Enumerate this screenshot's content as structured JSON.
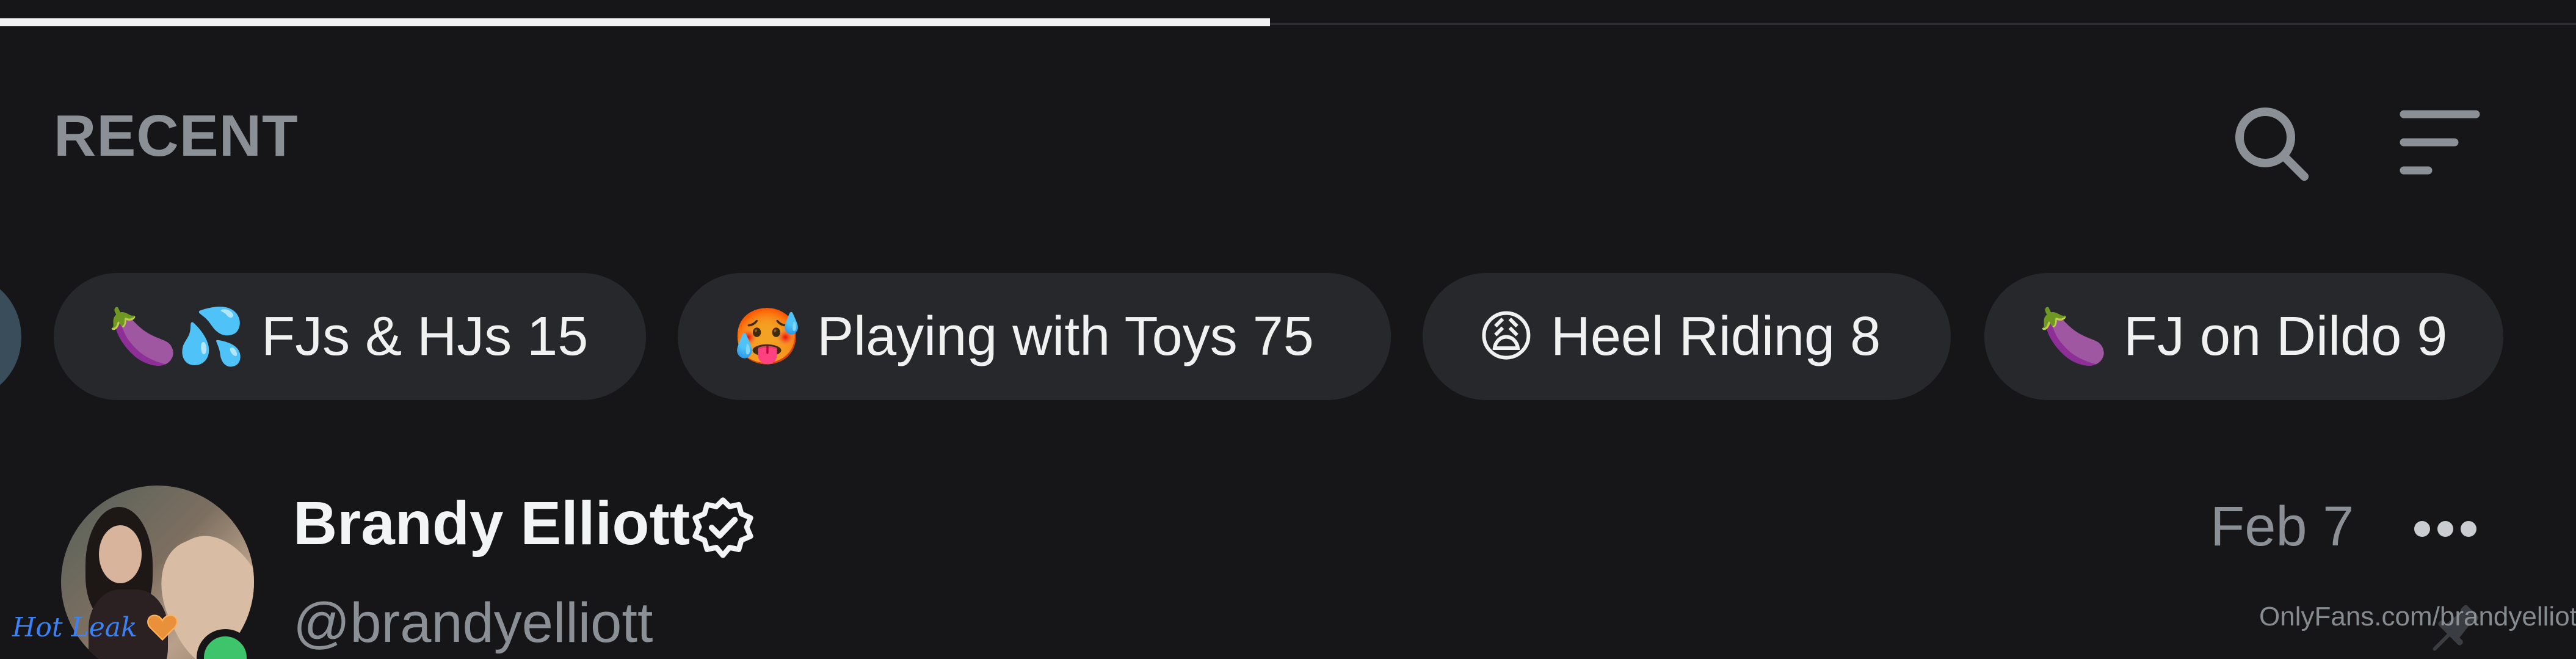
{
  "section": {
    "title": "RECENT"
  },
  "categories": [
    {
      "emoji": "🍆💦",
      "label": "FJs & HJs",
      "count": "15"
    },
    {
      "emoji": "🥵",
      "label": "Playing with Toys",
      "count": "75"
    },
    {
      "emoji": "😩",
      "label": "Heel Riding",
      "count": "8"
    },
    {
      "emoji": "🍆",
      "label": "FJ on Dildo",
      "count": "9"
    }
  ],
  "post": {
    "name": "Brandy Elliott",
    "handle": "@brandyelliott",
    "date": "Feb 7"
  },
  "watermark": {
    "right": "OnlyFans.com/brandyelliott",
    "left": "Hot Leak"
  },
  "icons": [
    "search-icon",
    "sort-icon",
    "verified-icon",
    "more-icon",
    "pin-icon",
    "heart-icon"
  ],
  "colors": {
    "background": "#161618",
    "chip": "#26282b",
    "muted_text": "#8a9096",
    "online": "#3ec56b"
  }
}
